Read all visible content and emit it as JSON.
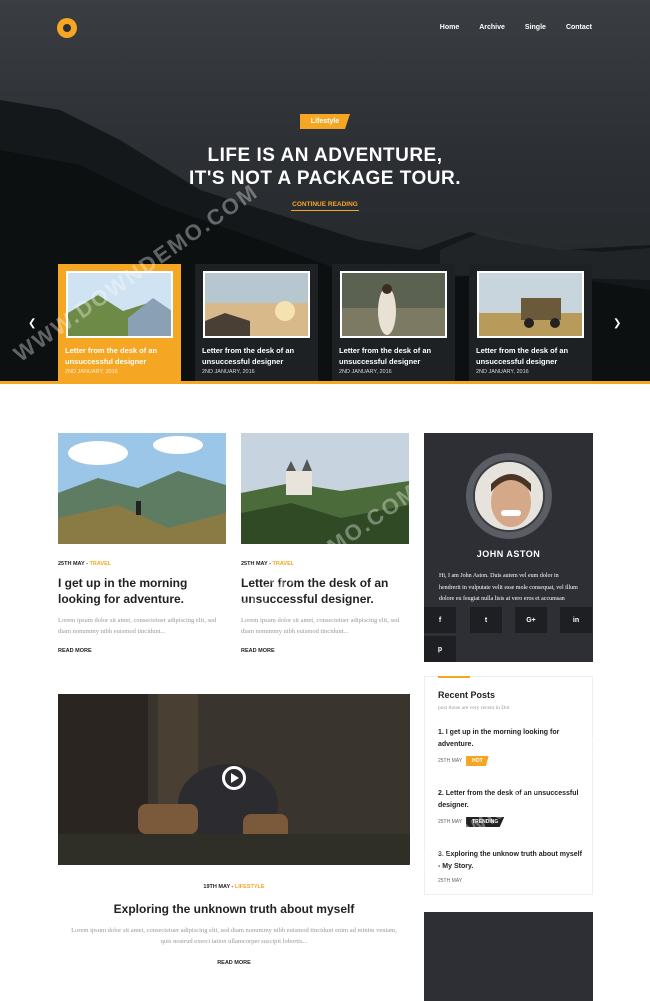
{
  "brand": {
    "accent": "#f5a623",
    "dark": "#2d2f34",
    "logo_icon": "logo-icon"
  },
  "nav": {
    "items": [
      "Home",
      "Archive",
      "Single",
      "Contact"
    ]
  },
  "hero": {
    "tag": "Lifestyle",
    "headline_line1": "LIFE IS AN ADVENTURE,",
    "headline_line2": "IT'S NOT A PACKAGE TOUR.",
    "cta": "CONTINUE READING",
    "prev_icon": "chevron-left-icon",
    "next_icon": "chevron-right-icon"
  },
  "slider": [
    {
      "title": "Letter from the desk of an unsuccessful designer",
      "date": "2ND JANUARY, 2016",
      "active": true
    },
    {
      "title": "Letter from the desk of an unsuccessful designer",
      "date": "2ND JANUARY, 2016",
      "active": false
    },
    {
      "title": "Letter from the desk of an unsuccessful designer",
      "date": "2ND JANUARY, 2016",
      "active": false
    },
    {
      "title": "Letter from the desk of an unsuccessful designer",
      "date": "2ND JANUARY, 2016",
      "active": false
    }
  ],
  "posts": [
    {
      "date": "25TH MAY",
      "sep": " - ",
      "category": "TRAVEL",
      "title": "I get up in the morning looking for adventure.",
      "excerpt": "Lorem ipsum dolor sit amet, consectetuer adipiscing elit, sed diam nonummy nibh euismod tincidunt...",
      "more": "READ MORE"
    },
    {
      "date": "25TH MAY",
      "sep": " - ",
      "category": "TRAVEL",
      "title": "Letter from the desk of an unsuccessful designer.",
      "excerpt": "Lorem ipsum dolor sit amet, consectetuer adipiscing elit, sed diam nonummy nibh euismod tincidunt...",
      "more": "READ MORE"
    }
  ],
  "video_post": {
    "date": "19TH MAY",
    "sep": " - ",
    "category": "LIFESTYLE",
    "title": "Exploring the unknown truth about myself",
    "excerpt": "Lorem ipsum dolor sit amet, consectetuer adipiscing elit, sed diam nonummy nibh euismod tincidunt enim ad minim veniam, quis nostrud exerci tation ullamcorper suscipit lobortis...",
    "more": "READ MORE",
    "play_icon": "play-icon"
  },
  "author": {
    "name": "JOHN ASTON",
    "bio": "Hi, I am John Aston. Duis autem vel eum dolor in hendrerit in vulputate velit esse mole consequat, vel illum dolore eu feugiat nulla lisis at vero eros et accumsan",
    "social": [
      "f",
      "t",
      "G+",
      "in",
      "p"
    ]
  },
  "recent": {
    "title": "Recent Posts",
    "subtitle": "post those are very recent in Dot",
    "items": [
      {
        "title": "1. I get up in the morning looking for adventure.",
        "date": "25TH MAY",
        "badge": "HOT",
        "badge_color": "#f5a623"
      },
      {
        "title": "2. Letter from the desk of an unsuccessful designer.",
        "date": "25TH MAY",
        "badge": "TRENDING",
        "badge_color": "#222222"
      },
      {
        "title": "3. Exploring the unknow truth about myself - My Story.",
        "date": "25TH MAY",
        "badge": "",
        "badge_color": ""
      }
    ]
  },
  "watermark": "WWW.DOWNDEMO.COM"
}
